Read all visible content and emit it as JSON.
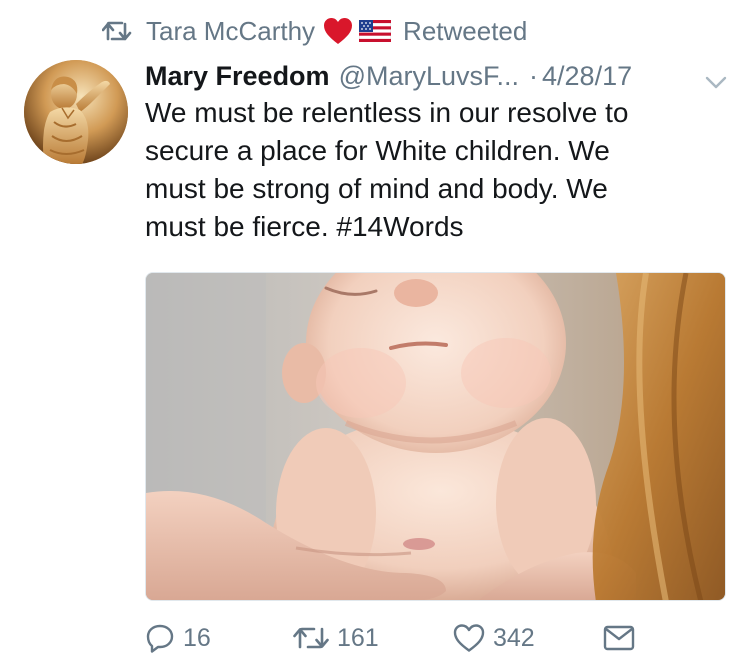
{
  "retweet_context": {
    "user_name": "Tara McCarthy",
    "heart_emoji": "❤️",
    "flag_emoji": "🇺🇸",
    "label": "Retweeted"
  },
  "tweet": {
    "author_name": "Mary Freedom",
    "author_handle": "@MaryLuvsF...",
    "separator": "·",
    "date": "4/28/17",
    "text_lines": [
      "We must be relentless in our resolve to",
      "secure a place for White children. We",
      "must be strong of mind and body. We",
      "must be fierce. #14Words"
    ],
    "actions": {
      "reply_count": "16",
      "retweet_count": "161",
      "like_count": "342"
    }
  },
  "colors": {
    "secondary_text": "#657786",
    "primary_text": "#14171a",
    "heart": "#e0245e"
  },
  "icons": {
    "retweet_context": "retweet-icon",
    "menu": "chevron-down-icon",
    "reply": "reply-icon",
    "retweet": "retweet-icon",
    "like": "heart-outline-icon",
    "dm": "envelope-icon"
  }
}
